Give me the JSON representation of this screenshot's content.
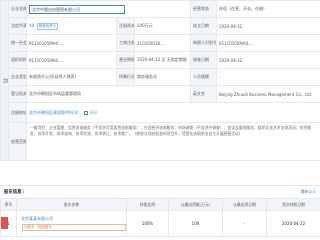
{
  "company": {
    "name": "北京中晨自由管理有限公司",
    "status_tag": "存续",
    "registered_tag": "在业",
    "tag2": "小微企业",
    "credit_code": "91110105MA0.....",
    "reg_capital": "100万元",
    "reg_number": "110105018....",
    "taxpayer_type": "",
    "legal_rep_label": "首席负责人",
    "company_type": "有限责任公司(自然人独资)",
    "industry": "商务服务业",
    "reg_date": "2020-04-22",
    "approval_date": "2020-04-22",
    "reg_authority": "北京市朝阳区市场监督管理局",
    "english_name": "Beijing Zhuodi Business Management Co., Ltd.",
    "address": "北京市朝阳区建国路甲92号...",
    "scope": "一般项目：企业管理；信息咨询服务（不含许可类信息咨询服务）；社会经济咨询服务；市场调查（不含涉外调查）；会议及展览服务；组织文化艺术交流活动；技术服务、技术开发、技术咨询、技术交流、技术转让、技术推广。（除依法须经批准的项目外，凭营业执照依法自主开展经营活动）"
  },
  "labels": {
    "l1": "企业名称",
    "l2": "法定代表人",
    "l3": "经营状态",
    "l4": "注册资本",
    "l5": "成立日期",
    "l6": "统一社会信用代码",
    "l7": "工商注册号",
    "l8": "纳税人识别号",
    "l9": "组织机构代码",
    "l10": "营业期限",
    "l11": "核准日期",
    "l12": "企业类型",
    "l13": "所属行业",
    "l14": "人员规模",
    "l15": "登记机关",
    "l16": "英文名",
    "l17": "注册地址",
    "l18": "经营范围",
    "first": "工商"
  },
  "values": {
    "legal_rep": "XX",
    "status": "存续（在营、开业、在册）",
    "capital": "100万元",
    "found_date": "2020-04-22",
    "reg_no": "110105018...",
    "term": "2020-04-22 至 无固定期限",
    "staff": "-",
    "copy": "复制"
  },
  "shareholders": {
    "title": "股东信息",
    "count": "1",
    "link": "最新公示",
    "headers": [
      "序号",
      "股东名称",
      "持股比例",
      "认缴出资额(万元)",
      "认缴出资日期",
      "首次持股日期"
    ],
    "rows": [
      {
        "no": "1",
        "name": "北京某某有限公司",
        "sub": "大股东 · 控股股东",
        "ratio": "100%",
        "amount": "100",
        "sub_date": "-",
        "first_date": "2020-04-22"
      }
    ]
  },
  "colors": {
    "accent": "#3a86d6",
    "header_bg": "#f2f6fb",
    "logo": "#d9534f"
  }
}
